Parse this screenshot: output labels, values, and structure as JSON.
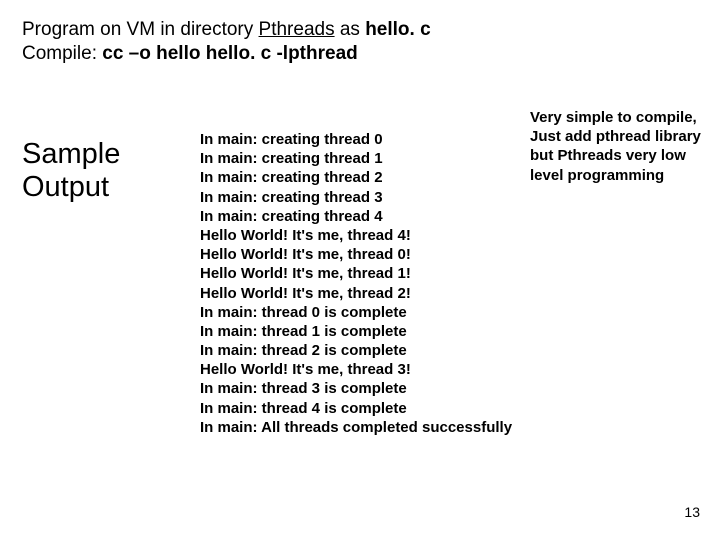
{
  "header": {
    "pre1": "Program on VM in directory ",
    "dir": "Pthreads",
    "mid1": " as ",
    "file": "hello. c",
    "pre2": "Compile: ",
    "cmd": "cc –o hello hello. c -lpthread"
  },
  "left_title": {
    "l1": "Sample",
    "l2": "Output"
  },
  "output_lines": {
    "l0": "In main: creating thread 0",
    "l1": "In main: creating thread 1",
    "l2": "In main: creating thread 2",
    "l3": "In main: creating thread 3",
    "l4": "In main: creating thread 4",
    "l5": "Hello World! It's me, thread 4!",
    "l6": "Hello World! It's me, thread 0!",
    "l7": "Hello World! It's me, thread 1!",
    "l8": "Hello World! It's me, thread 2!",
    "l9": "In main: thread 0 is complete",
    "l10": "In main: thread 1 is complete",
    "l11": "In main: thread 2 is complete",
    "l12": "Hello World! It's me, thread 3!",
    "l13": "In main: thread 3 is complete",
    "l14": "In main: thread 4 is complete",
    "l15": "In main: All threads completed successfully"
  },
  "note": {
    "l0": "Very simple to compile,",
    "l1": "Just add pthread library",
    "l2": "but Pthreads very low",
    "l3": "level programming"
  },
  "page_number": "13"
}
